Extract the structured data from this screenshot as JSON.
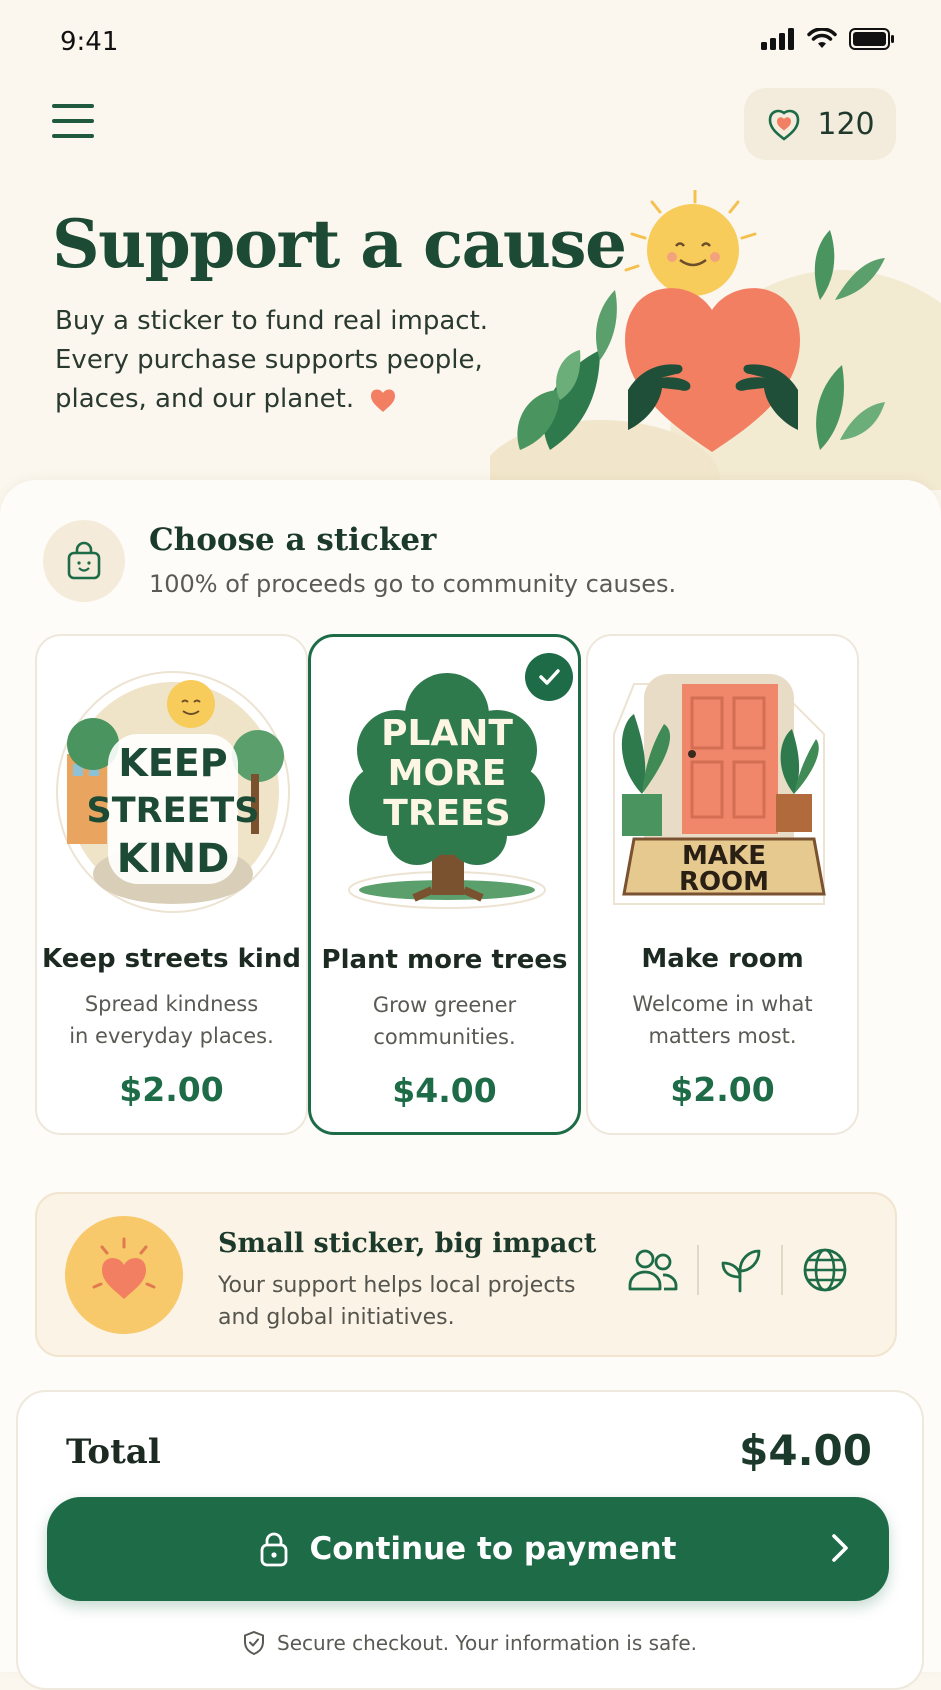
{
  "status_bar": {
    "time": "9:41"
  },
  "header": {
    "points_value": "120",
    "points_icon": "heart-hands-icon",
    "menu_icon": "hamburger-icon"
  },
  "hero": {
    "title": "Support a cause",
    "subtitle_lines": [
      "Buy a sticker to fund real impact.",
      "Every purchase supports people,",
      "places, and our planet."
    ]
  },
  "choose": {
    "title": "Choose a sticker",
    "subtitle": "100% of proceeds go to community causes."
  },
  "stickers": [
    {
      "art_text": [
        "KEEP",
        "STREETS",
        "KIND"
      ],
      "title": "Keep streets kind",
      "desc_lines": [
        "Spread kindness",
        "in everyday places."
      ],
      "price": "$2.00",
      "selected": false
    },
    {
      "art_text": [
        "PLANT",
        "MORE",
        "TREES"
      ],
      "title": "Plant more trees",
      "desc_lines": [
        "Grow greener",
        "communities."
      ],
      "price": "$4.00",
      "selected": true
    },
    {
      "art_text": [
        "MAKE",
        "ROOM"
      ],
      "title": "Make room",
      "desc_lines": [
        "Welcome in what",
        "matters most."
      ],
      "price": "$2.00",
      "selected": false
    }
  ],
  "impact": {
    "title": "Small sticker, big impact",
    "desc_lines": [
      "Your support helps local projects",
      "and global initiatives."
    ],
    "icons": [
      "people-icon",
      "sprout-icon",
      "globe-icon"
    ]
  },
  "checkout": {
    "total_label": "Total",
    "total_value": "$4.00",
    "button_label": "Continue to payment",
    "secure_note": "Secure checkout. Your information is safe."
  },
  "colors": {
    "brand_green": "#1D6B47",
    "background": "#FBF7EE",
    "heart_coral": "#F27F62",
    "sun_yellow": "#F8C96A"
  }
}
